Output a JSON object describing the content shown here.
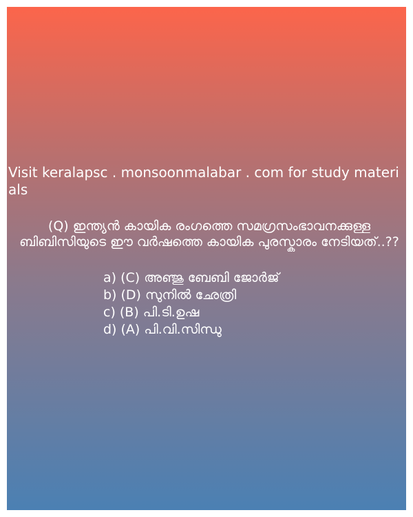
{
  "promo_text": "Visit keralapsc . monsoonmalabar . com for study materials",
  "question": "(Q) ഇന്ത്യന്‍ കായിക രംഗത്തെ സമഗ്രസംഭാവനക്കുള്ള ബിബിസിയുടെ ഈ വര്‍ഷത്തെ കായിക പുരസ്കാരം നേടിയത്..??",
  "options": [
    "a) (C) അഞ്ജു ബേബി ജോര്‍ജ്",
    "b) (D) സുനില്‍ ഛേത്രി",
    "c) (B) പി.ടി.ഉഷ",
    "d) (A) പി.വി.സിന്ധു"
  ],
  "colors": {
    "gradient_top": "#fc654b",
    "gradient_bottom": "#4b80b3",
    "text": "#ffffff"
  }
}
